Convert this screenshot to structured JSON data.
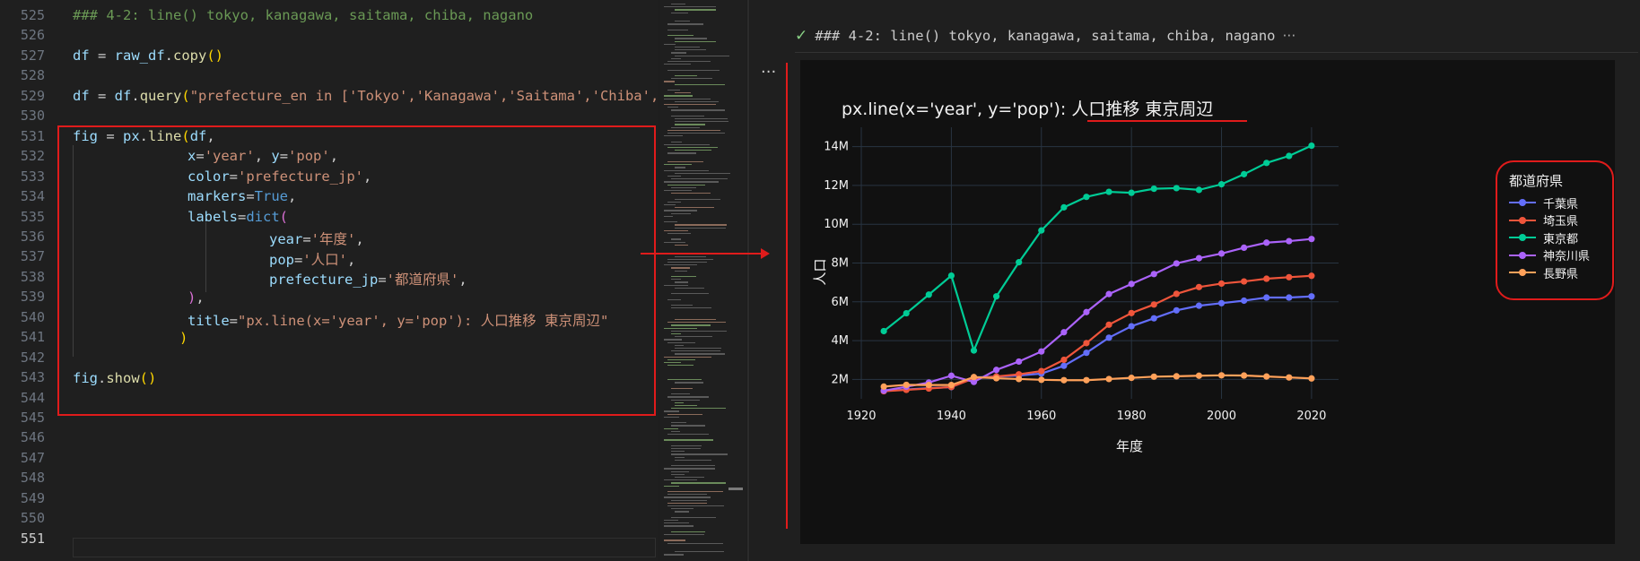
{
  "editor": {
    "line_numbers": [
      "525",
      "526",
      "527",
      "528",
      "529",
      "530",
      "531",
      "532",
      "533",
      "534",
      "535",
      "536",
      "537",
      "538",
      "539",
      "540",
      "541",
      "542",
      "543",
      "544",
      "545",
      "546",
      "547",
      "548",
      "549",
      "550",
      "551"
    ],
    "active_line": "551",
    "code": {
      "l525": "### 4-2: line() tokyo, kanagawa, saitama, chiba, nagano",
      "l527_a": "df",
      "l527_b": " = ",
      "l527_c": "raw_df",
      "l527_d": ".",
      "l527_e": "copy",
      "l527_f": "()",
      "l529_a": "df",
      "l529_b": " = ",
      "l529_c": "df",
      "l529_d": ".",
      "l529_e": "query",
      "l529_f": "(",
      "l529_g": "\"prefecture_en in ['Tokyo','Kanagawa','Saitama','Chiba','",
      "l531_a": "fig",
      "l531_b": " = ",
      "l531_c": "px",
      "l531_d": ".",
      "l531_e": "line",
      "l531_f": "(",
      "l531_g": "df",
      "l531_h": ",",
      "l532_a": "x",
      "l532_b": "=",
      "l532_c": "'year'",
      "l532_d": ", ",
      "l532_e": "y",
      "l532_f": "=",
      "l532_g": "'pop'",
      "l532_h": ",",
      "l533_a": "color",
      "l533_b": "=",
      "l533_c": "'prefecture_jp'",
      "l533_d": ",",
      "l534_a": "markers",
      "l534_b": "=",
      "l534_c": "True",
      "l534_d": ",",
      "l535_a": "labels",
      "l535_b": "=",
      "l535_c": "dict",
      "l535_d": "(",
      "l536_a": "year",
      "l536_b": "=",
      "l536_c": "'年度'",
      "l536_d": ",",
      "l537_a": "pop",
      "l537_b": "=",
      "l537_c": "'人口'",
      "l537_d": ",",
      "l538_a": "prefecture_jp",
      "l538_b": "=",
      "l538_c": "'都道府県'",
      "l538_d": ",",
      "l539_a": ")",
      "l539_b": ",",
      "l540_a": "title",
      "l540_b": "=",
      "l540_c": "\"px.line(x='year', y='pop'): 人口推移 東京周辺\"",
      "l541_a": ")",
      "l543_a": "fig",
      "l543_b": ".",
      "l543_c": "show",
      "l543_d": "()"
    }
  },
  "output": {
    "header_check": "✓",
    "header_text": "### 4-2: line() tokyo, kanagawa, saitama, chiba, nagano",
    "header_ellipsis": "···",
    "cell_menu": "···"
  },
  "colors": {
    "highlight": "#e01b1b",
    "chiba": "#636efa",
    "saitama": "#ef553b",
    "tokyo": "#00cc96",
    "kanagawa": "#ab63fa",
    "nagano": "#ffa15a"
  },
  "chart_data": {
    "type": "line",
    "title_prefix": "px.line(x='year', y='pop'): ",
    "title_suffix": "人口推移 東京周辺",
    "xlabel": "年度",
    "ylabel": "人口",
    "xlim": [
      1918,
      2026
    ],
    "ylim": [
      1000000,
      15000000
    ],
    "xticks": [
      1920,
      1940,
      1960,
      1980,
      2000,
      2020
    ],
    "yticks": [
      2000000,
      4000000,
      6000000,
      8000000,
      10000000,
      12000000,
      14000000
    ],
    "ytick_labels": [
      "2M",
      "4M",
      "6M",
      "8M",
      "10M",
      "12M",
      "14M"
    ],
    "grid": true,
    "legend_title": "都道府県",
    "legend_position": "right",
    "x": [
      1925,
      1930,
      1935,
      1940,
      1945,
      1950,
      1955,
      1960,
      1965,
      1970,
      1975,
      1980,
      1985,
      1990,
      1995,
      2000,
      2005,
      2010,
      2015,
      2020
    ],
    "series": [
      {
        "name": "千葉県",
        "color": "#636efa",
        "values": [
          1400000,
          1480000,
          1550000,
          1600000,
          2100000,
          2150000,
          2200000,
          2300000,
          2700000,
          3370000,
          4150000,
          4740000,
          5150000,
          5560000,
          5800000,
          5930000,
          6060000,
          6220000,
          6220000,
          6280000
        ]
      },
      {
        "name": "埼玉県",
        "color": "#ef553b",
        "values": [
          1390000,
          1460000,
          1530000,
          1610000,
          2050000,
          2150000,
          2260000,
          2430000,
          3010000,
          3870000,
          4820000,
          5420000,
          5860000,
          6410000,
          6760000,
          6940000,
          7050000,
          7190000,
          7270000,
          7340000
        ]
      },
      {
        "name": "東京都",
        "color": "#00cc96",
        "values": [
          4490000,
          5410000,
          6370000,
          7350000,
          3490000,
          6280000,
          8040000,
          9680000,
          10870000,
          11410000,
          11670000,
          11620000,
          11830000,
          11860000,
          11770000,
          12060000,
          12580000,
          13160000,
          13520000,
          14050000
        ]
      },
      {
        "name": "神奈川県",
        "color": "#ab63fa",
        "values": [
          1420000,
          1620000,
          1840000,
          2190000,
          1870000,
          2490000,
          2920000,
          3440000,
          4430000,
          5470000,
          6400000,
          6920000,
          7430000,
          7980000,
          8250000,
          8490000,
          8790000,
          9050000,
          9130000,
          9240000
        ]
      },
      {
        "name": "長野県",
        "color": "#ffa15a",
        "values": [
          1630000,
          1720000,
          1710000,
          1710000,
          2120000,
          2060000,
          2020000,
          1980000,
          1960000,
          1960000,
          2020000,
          2080000,
          2140000,
          2160000,
          2190000,
          2210000,
          2200000,
          2150000,
          2100000,
          2050000
        ]
      }
    ]
  }
}
